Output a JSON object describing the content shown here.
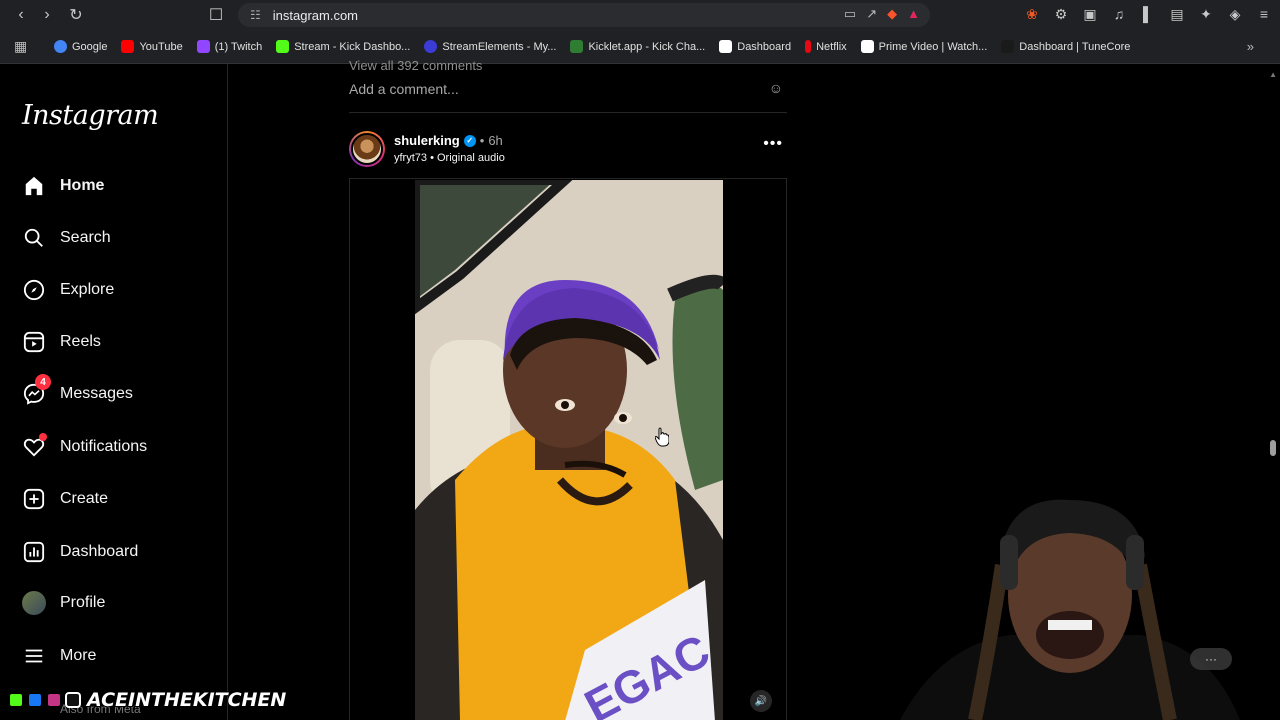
{
  "browser": {
    "url": "instagram.com",
    "bookmarks": [
      {
        "label": "Google",
        "color": "#4285f4"
      },
      {
        "label": "YouTube",
        "color": "#ff0000"
      },
      {
        "label": "(1) Twitch",
        "color": "#9146ff"
      },
      {
        "label": "Stream - Kick Dashbo...",
        "color": "#53fc18"
      },
      {
        "label": "StreamElements - My...",
        "color": "#3b3bd6"
      },
      {
        "label": "Kicklet.app - Kick Cha...",
        "color": "#2e7d32"
      },
      {
        "label": "Dashboard",
        "color": "#ffffff"
      },
      {
        "label": "Netflix",
        "color": "#e50914"
      },
      {
        "label": "Prime Video | Watch...",
        "color": "#ffffff"
      },
      {
        "label": "Dashboard | TuneCore",
        "color": "#1a1a1a"
      }
    ]
  },
  "sidebar": {
    "logo": "Instagram",
    "items": [
      {
        "label": "Home",
        "icon": "home-icon"
      },
      {
        "label": "Search",
        "icon": "search-icon"
      },
      {
        "label": "Explore",
        "icon": "compass-icon"
      },
      {
        "label": "Reels",
        "icon": "reels-icon"
      },
      {
        "label": "Messages",
        "icon": "messenger-icon",
        "badge": "4"
      },
      {
        "label": "Notifications",
        "icon": "heart-icon"
      },
      {
        "label": "Create",
        "icon": "plus-square-icon"
      },
      {
        "label": "Dashboard",
        "icon": "chart-icon"
      },
      {
        "label": "Profile",
        "icon": "avatar"
      },
      {
        "label": "More",
        "icon": "menu-icon"
      }
    ],
    "footer": "Also from Meta"
  },
  "feed": {
    "view_comments": "View all 392 comments",
    "add_comment_placeholder": "Add a comment...",
    "post": {
      "username": "shulerking",
      "time": "6h",
      "audio": "yfryt73 • Original audio"
    }
  },
  "overlay": {
    "channel_name": "ACEINTHEKITCHEN",
    "chip": "···"
  }
}
